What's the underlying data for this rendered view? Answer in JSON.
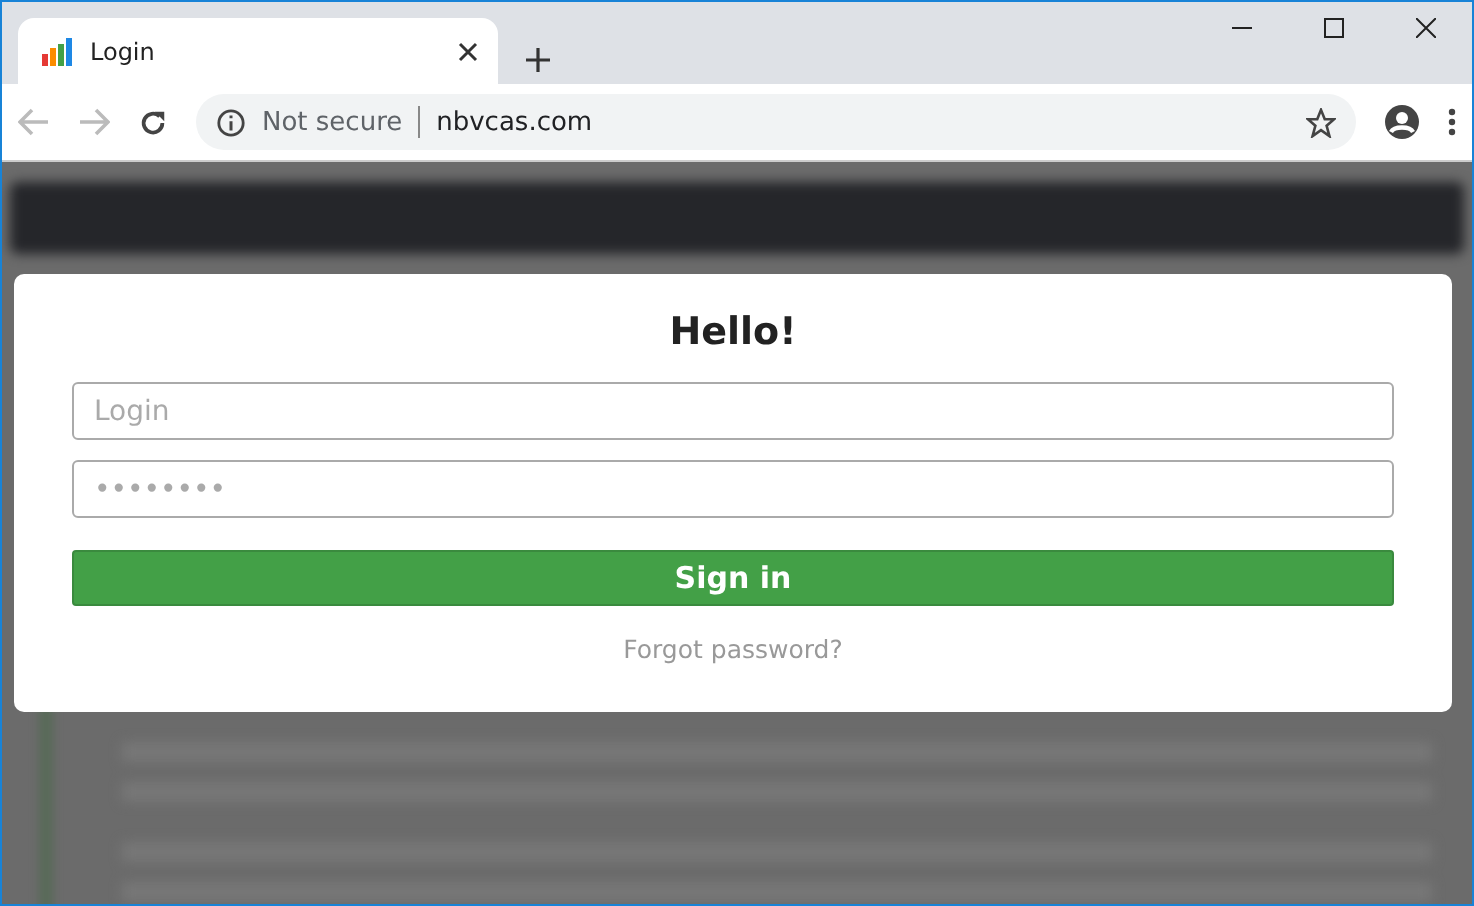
{
  "tab": {
    "title": "Login",
    "selected": true
  },
  "address_bar": {
    "security": "Not secure",
    "url": "nbvcas.com"
  },
  "dialog": {
    "title": "Hello!",
    "fields": [
      {
        "placeholder": "Login"
      },
      {
        "placeholder": "••••••••"
      }
    ],
    "submit": "Sign in",
    "link": "Forgot password?"
  }
}
